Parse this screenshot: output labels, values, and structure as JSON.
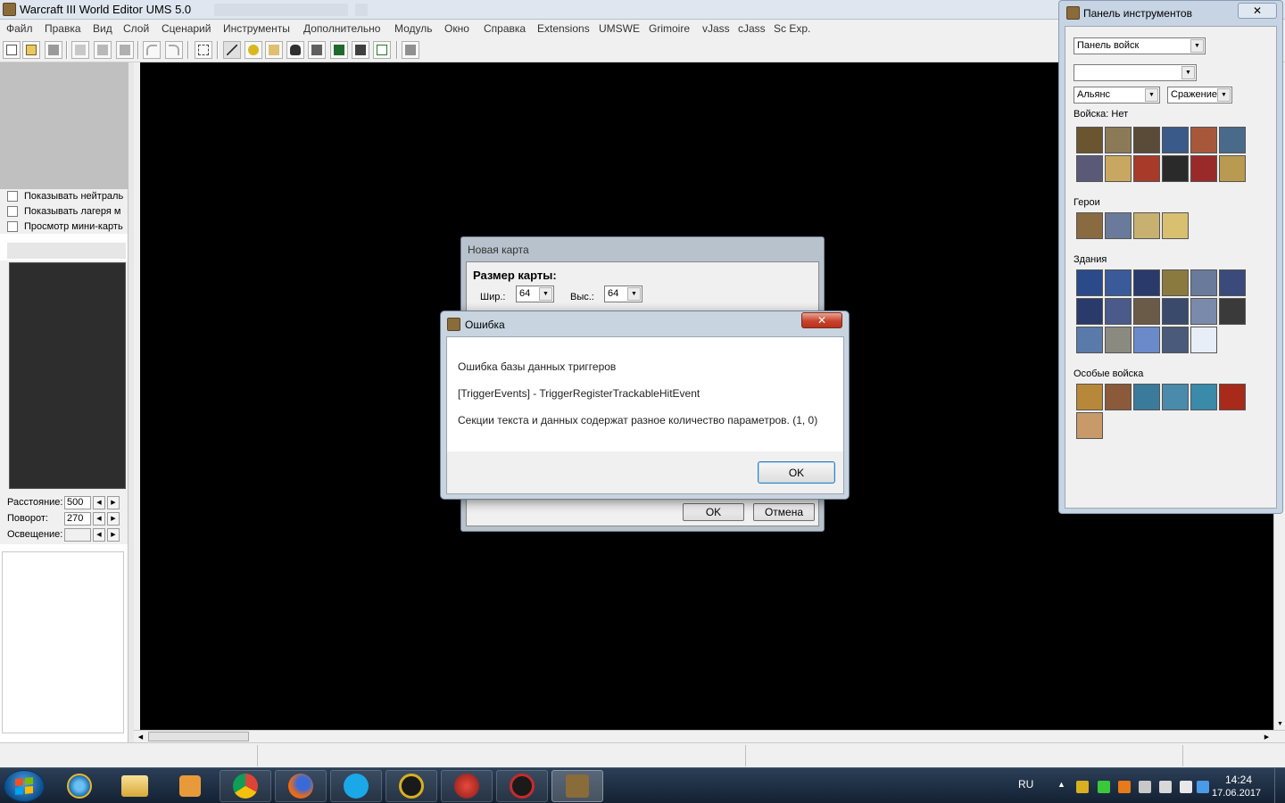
{
  "window": {
    "title": "Warcraft III World Editor UMS 5.0"
  },
  "menu": [
    "Файл",
    "Правка",
    "Вид",
    "Слой",
    "Сценарий",
    "Инструменты",
    "Дополнительно",
    "Модуль",
    "Окно",
    "Справка",
    "Extensions",
    "UMSWE",
    "Grimoire",
    "vJass",
    "cJass",
    "Sc Exp."
  ],
  "left_panel": {
    "checkboxes": [
      "Показывать нейтраль",
      "Показывать лагеря м",
      "Просмотр мини-карть"
    ],
    "params": [
      {
        "label": "Расстояние:",
        "value": "500"
      },
      {
        "label": "Поворот:",
        "value": "270"
      },
      {
        "label": "Освещение:",
        "value": ""
      }
    ]
  },
  "palette": {
    "title": "Панель инструментов",
    "close": "✕",
    "mode_combo": "Панель войск",
    "filter_combo": "",
    "race_combo": "Альянс",
    "type_combo": "Сражение",
    "sections": {
      "units": "Войска: Нет",
      "heroes": "Герои",
      "buildings": "Здания",
      "special": "Особые войска"
    }
  },
  "new_map": {
    "title": "Новая карта",
    "heading": "Размер карты:",
    "width_label": "Шир.:",
    "width_value": "64",
    "height_label": "Выс.:",
    "height_value": "64",
    "ok": "OK",
    "cancel": "Отмена"
  },
  "error_dialog": {
    "title": "Ошибка",
    "close": "✕",
    "line1": "Ошибка базы данных триггеров",
    "line2": "[TriggerEvents] - TriggerRegisterTrackableHitEvent",
    "line3": "Секции текста и данных содержат разное количество параметров. (1, 0)",
    "ok": "OK"
  },
  "taskbar": {
    "lang": "RU",
    "time": "14:24",
    "date": "17.06.2017"
  }
}
